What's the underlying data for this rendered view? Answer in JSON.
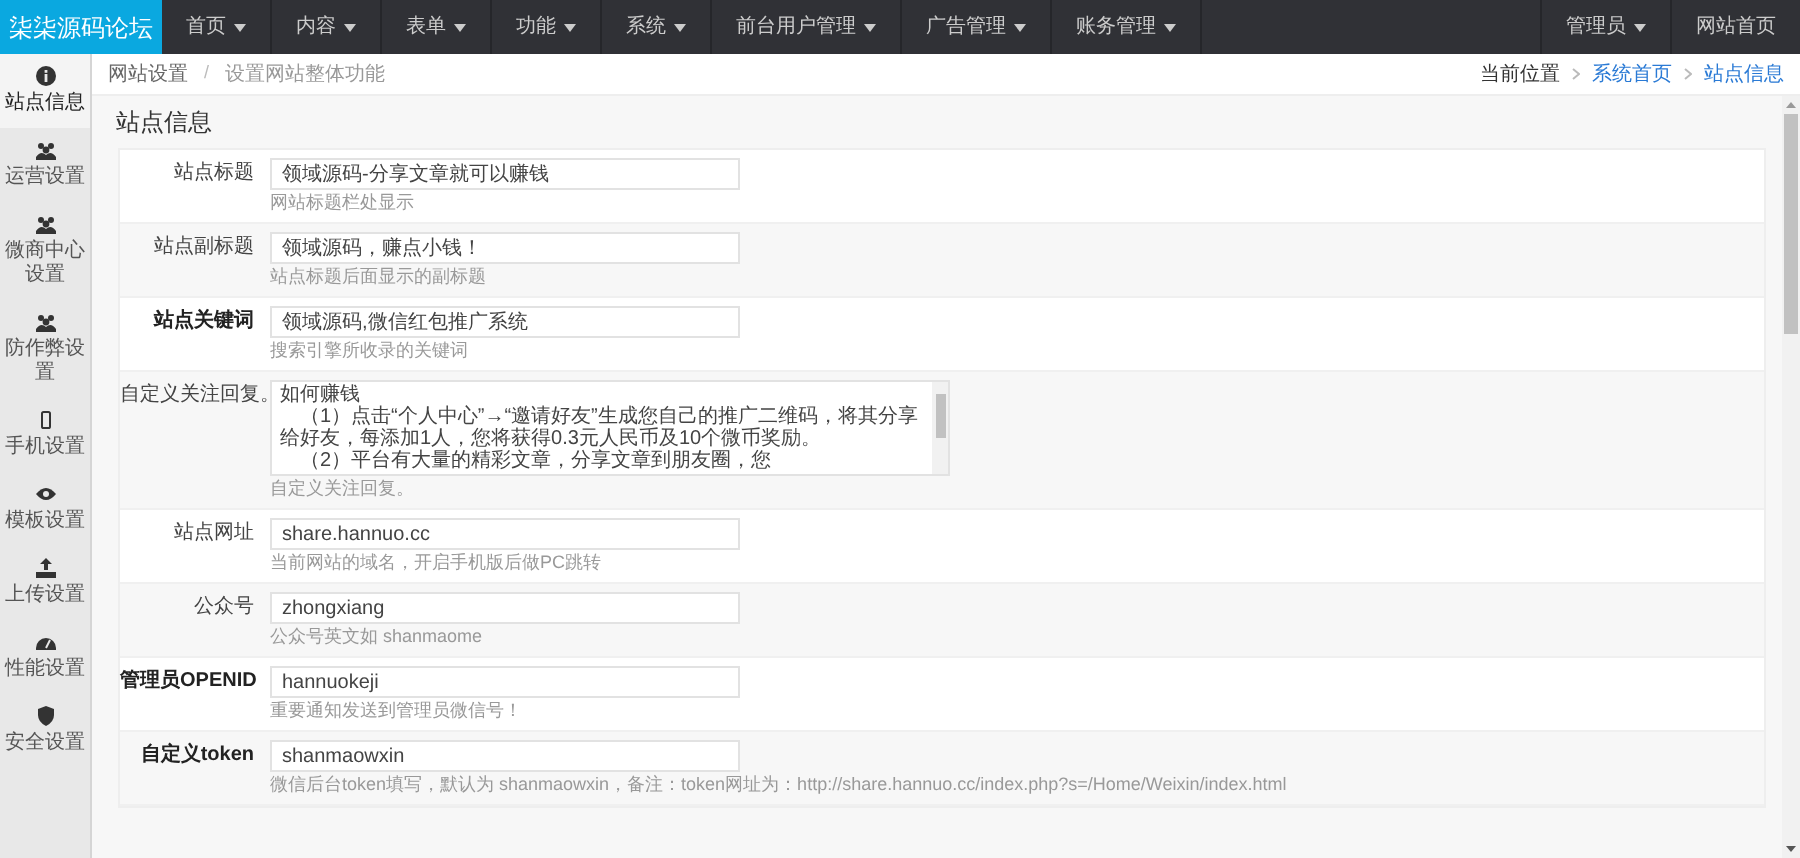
{
  "brand": "柒柒源码论坛",
  "nav": [
    {
      "label": "首页"
    },
    {
      "label": "内容"
    },
    {
      "label": "表单"
    },
    {
      "label": "功能"
    },
    {
      "label": "系统"
    },
    {
      "label": "前台用户管理"
    },
    {
      "label": "广告管理"
    },
    {
      "label": "账务管理"
    }
  ],
  "nav_right": {
    "user": "管理员",
    "home": "网站首页"
  },
  "sidebar": {
    "items": [
      {
        "label": "站点信息",
        "selected": true
      },
      {
        "label": "运营设置",
        "selected": false
      },
      {
        "label": "微商中心设置",
        "selected": false
      },
      {
        "label": "防作弊设置",
        "selected": false
      },
      {
        "label": "手机设置",
        "selected": false
      },
      {
        "label": "模板设置",
        "selected": false
      },
      {
        "label": "上传设置",
        "selected": false
      },
      {
        "label": "性能设置",
        "selected": false
      },
      {
        "label": "安全设置",
        "selected": false
      }
    ]
  },
  "page_header": {
    "title": "网站设置",
    "separator": "/",
    "subtitle": "设置网站整体功能",
    "location_label": "当前位置",
    "breadcrumb": [
      "系统首页",
      "站点信息"
    ]
  },
  "section_title": "站点信息",
  "fields": [
    {
      "kind": "input",
      "label": "站点标题",
      "bold": false,
      "value": "领域源码-分享文章就可以赚钱",
      "hint": "网站标题栏处显示"
    },
    {
      "kind": "input",
      "label": "站点副标题",
      "bold": false,
      "value": "领域源码，赚点小钱！",
      "hint": "站点标题后面显示的副标题"
    },
    {
      "kind": "input",
      "label": "站点关键词",
      "bold": true,
      "value": "领域源码,微信红包推广系统",
      "hint": "搜索引擎所收录的关键词"
    },
    {
      "kind": "textarea",
      "label": "自定义关注回复。",
      "bold": false,
      "value_lines": [
        "如何赚钱",
        "　（1）点击“个人中心”→“邀请好友”生成您自己的推广二维码，将其分享给好友，每添加1人，您将获得0.3元人民币及10个微币奖励。",
        "　（2）平台有大量的精彩文章，分享文章到朋友圈，您"
      ],
      "hint": "自定义关注回复。"
    },
    {
      "kind": "input",
      "label": "站点网址",
      "bold": false,
      "value": "share.hannuo.cc",
      "hint": "当前网站的域名，开启手机版后做PC跳转"
    },
    {
      "kind": "input",
      "label": "公众号",
      "bold": false,
      "value": "zhongxiang",
      "hint": "公众号英文如 shanmaome"
    },
    {
      "kind": "input",
      "label": "管理员OPENID",
      "bold": true,
      "value": "hannuokeji",
      "hint": "重要通知发送到管理员微信号！"
    },
    {
      "kind": "input",
      "label": "自定义token",
      "bold": true,
      "value": "shanmaowxin",
      "hint": "微信后台token填写，默认为 shanmaowxin，备注：token网址为：http://share.hannuo.cc/index.php?s=/Home/Weixin/index.html"
    }
  ]
}
